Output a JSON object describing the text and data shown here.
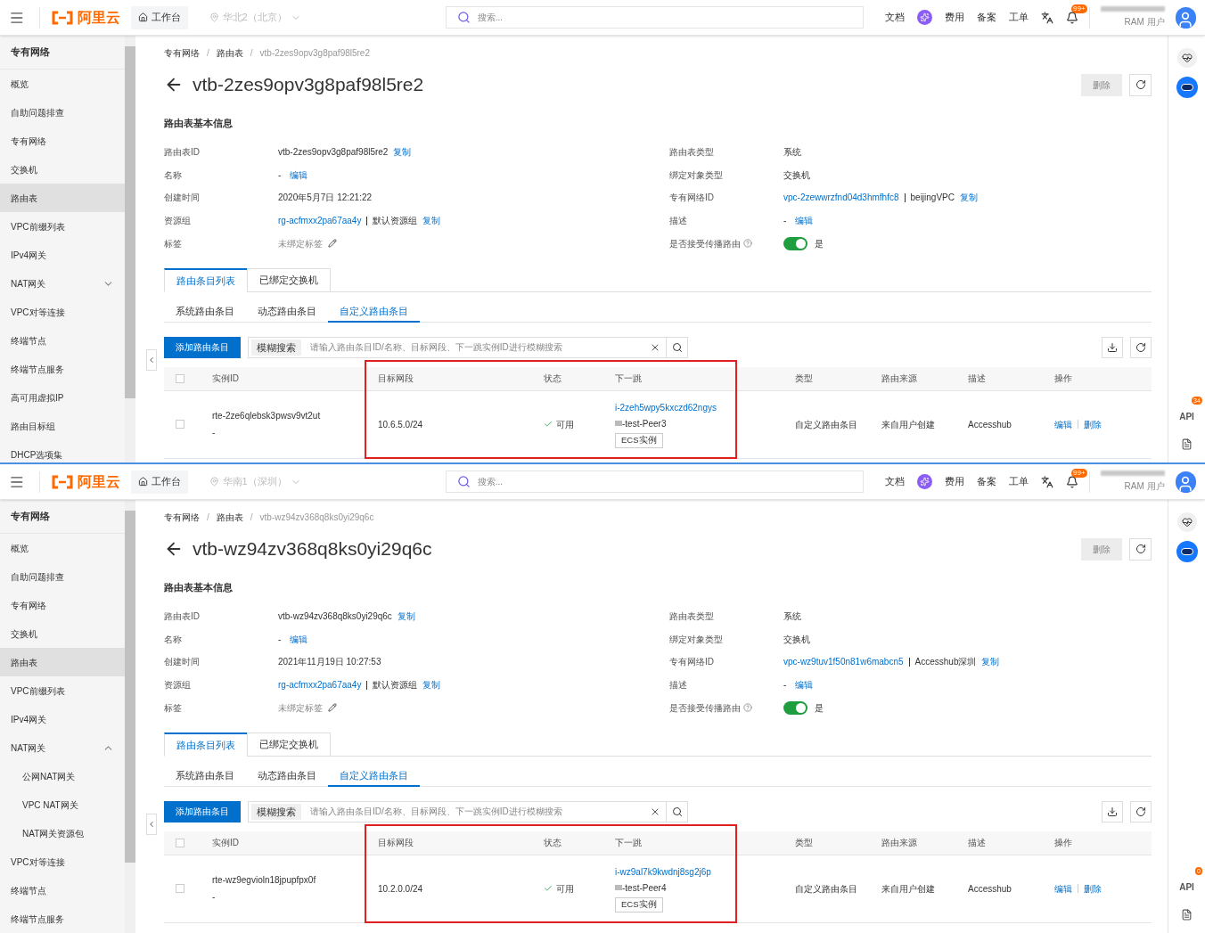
{
  "panels": [
    {
      "header": {
        "logo": "阿里云",
        "workbench": "工作台",
        "region": "华北2（北京）",
        "search_placeholder": "搜索...",
        "nav": [
          {
            "kind": "link",
            "label": "文档"
          },
          {
            "kind": "ai"
          },
          {
            "kind": "link",
            "label": "费用"
          },
          {
            "kind": "link",
            "label": "备案"
          },
          {
            "kind": "link",
            "label": "工单"
          },
          {
            "kind": "translate"
          },
          {
            "kind": "bell",
            "badge": "99+"
          }
        ],
        "user_role": "RAM 用户"
      },
      "sidebar": {
        "title": "专有网络",
        "items": [
          {
            "label": "概览",
            "selected": false
          },
          {
            "label": "自助问题排查",
            "selected": false
          },
          {
            "label": "专有网络",
            "selected": false
          },
          {
            "label": "交换机",
            "selected": false
          },
          {
            "label": "路由表",
            "selected": true
          },
          {
            "label": "VPC前缀列表",
            "selected": false
          },
          {
            "label": "IPv4网关",
            "selected": false
          },
          {
            "label": "NAT网关",
            "selected": false,
            "expanded": false
          },
          {
            "label": "VPC对等连接",
            "selected": false
          },
          {
            "label": "终端节点",
            "selected": false
          },
          {
            "label": "终端节点服务",
            "selected": false
          },
          {
            "label": "高可用虚拟IP",
            "selected": false
          },
          {
            "label": "路由目标组",
            "selected": false
          },
          {
            "label": "DHCP选项集",
            "selected": false
          }
        ]
      },
      "breadcrumb": [
        "专有网络",
        "路由表",
        "vtb-2zes9opv3g8paf98l5re2"
      ],
      "breadcrumb_separator": "/",
      "title": "vtb-2zes9opv3g8paf98l5re2",
      "delete_button": {
        "label": "删除",
        "disabled": true
      },
      "section_title": "路由表基本信息",
      "details_left": [
        {
          "kind": "copyable",
          "label": "路由表ID",
          "value": "vtb-2zes9opv3g8paf98l5re2",
          "action": "复制"
        },
        {
          "kind": "editable",
          "label": "名称",
          "value": "-",
          "action": "编辑"
        },
        {
          "kind": "text",
          "label": "创建时间",
          "value": "2020年5月7日 12:21:22"
        },
        {
          "kind": "link_pair",
          "label": "资源组",
          "link": "rg-acfmxx2pa67aa4y",
          "name": "默认资源组",
          "action": "复制"
        },
        {
          "kind": "tag",
          "label": "标签",
          "value": "未绑定标签"
        }
      ],
      "details_right": [
        {
          "kind": "text",
          "label": "路由表类型",
          "value": "系统"
        },
        {
          "kind": "text",
          "label": "绑定对象类型",
          "value": "交换机"
        },
        {
          "kind": "link_pair",
          "label": "专有网络ID",
          "link": "vpc-2zewwrzfnd04d3hmfhfc8",
          "name": "beijingVPC",
          "action": "复制"
        },
        {
          "kind": "editable",
          "label": "描述",
          "value": "-",
          "action": "编辑"
        },
        {
          "kind": "toggle",
          "label": "是否接受传播路由",
          "on": true,
          "value": "是"
        }
      ],
      "tabs": [
        {
          "label": "路由条目列表",
          "selected": true
        },
        {
          "label": "已绑定交换机",
          "selected": false
        }
      ],
      "subtabs": [
        {
          "label": "系统路由条目",
          "selected": false
        },
        {
          "label": "动态路由条目",
          "selected": false
        },
        {
          "label": "自定义路由条目",
          "selected": true
        }
      ],
      "toolbar": {
        "add": "添加路由条目",
        "filter": "模糊搜索",
        "placeholder": "请输入路由条目ID/名称、目标网段、下一跳实例ID进行模糊搜索"
      },
      "table": {
        "header_checked": false,
        "columns": [
          "实例ID",
          "目标网段",
          "状态",
          "下一跳",
          "类型",
          "路由来源",
          "描述",
          "操作"
        ],
        "rows": [
          {
            "checked": false,
            "instance_id": "rte-2ze6qlebsk3pwsv9vt2ut",
            "instance_name": "-",
            "destination": "10.6.5.0/24",
            "status": {
              "kind": "available",
              "label": "可用"
            },
            "next_hop": {
              "id": "i-2zeh5wpy5kxczd62ngys",
              "name": "-test-Peer3",
              "type": "ECS实例"
            },
            "type": "自定义路由条目",
            "source": "来自用户创建",
            "description": "Accesshub",
            "actions": [
              "编辑",
              "删除"
            ]
          }
        ]
      },
      "rail_api": "API",
      "rail_badge": "34"
    },
    {
      "header": {
        "logo": "阿里云",
        "workbench": "工作台",
        "region": "华南1（深圳）",
        "search_placeholder": "搜索...",
        "nav": [
          {
            "kind": "link",
            "label": "文档"
          },
          {
            "kind": "ai"
          },
          {
            "kind": "link",
            "label": "费用"
          },
          {
            "kind": "link",
            "label": "备案"
          },
          {
            "kind": "link",
            "label": "工单"
          },
          {
            "kind": "translate"
          },
          {
            "kind": "bell",
            "badge": "99+"
          }
        ],
        "user_role": "RAM 用户"
      },
      "sidebar": {
        "title": "专有网络",
        "items": [
          {
            "label": "概览",
            "selected": false
          },
          {
            "label": "自助问题排查",
            "selected": false
          },
          {
            "label": "专有网络",
            "selected": false
          },
          {
            "label": "交换机",
            "selected": false
          },
          {
            "label": "路由表",
            "selected": true
          },
          {
            "label": "VPC前缀列表",
            "selected": false
          },
          {
            "label": "IPv4网关",
            "selected": false
          },
          {
            "label": "NAT网关",
            "selected": false,
            "expanded": true,
            "children": [
              {
                "label": "公网NAT网关",
                "selected": false
              },
              {
                "label": "VPC NAT网关",
                "selected": false
              },
              {
                "label": "NAT网关资源包",
                "selected": false
              }
            ]
          },
          {
            "label": "VPC对等连接",
            "selected": false
          },
          {
            "label": "终端节点",
            "selected": false
          },
          {
            "label": "终端节点服务",
            "selected": false
          }
        ]
      },
      "breadcrumb": [
        "专有网络",
        "路由表",
        "vtb-wz94zv368q8ks0yi29q6c"
      ],
      "breadcrumb_separator": "/",
      "title": "vtb-wz94zv368q8ks0yi29q6c",
      "delete_button": {
        "label": "删除",
        "disabled": true
      },
      "section_title": "路由表基本信息",
      "details_left": [
        {
          "kind": "copyable",
          "label": "路由表ID",
          "value": "vtb-wz94zv368q8ks0yi29q6c",
          "action": "复制"
        },
        {
          "kind": "editable",
          "label": "名称",
          "value": "-",
          "action": "编辑"
        },
        {
          "kind": "text",
          "label": "创建时间",
          "value": "2021年11月19日 10:27:53"
        },
        {
          "kind": "link_pair",
          "label": "资源组",
          "link": "rg-acfmxx2pa67aa4y",
          "name": "默认资源组",
          "action": "复制"
        },
        {
          "kind": "tag",
          "label": "标签",
          "value": "未绑定标签"
        }
      ],
      "details_right": [
        {
          "kind": "text",
          "label": "路由表类型",
          "value": "系统"
        },
        {
          "kind": "text",
          "label": "绑定对象类型",
          "value": "交换机"
        },
        {
          "kind": "link_pair",
          "label": "专有网络ID",
          "link": "vpc-wz9tuv1f50n81w6mabcn5",
          "name": "Accesshub深圳",
          "action": "复制"
        },
        {
          "kind": "editable",
          "label": "描述",
          "value": "-",
          "action": "编辑"
        },
        {
          "kind": "toggle",
          "label": "是否接受传播路由",
          "on": true,
          "value": "是"
        }
      ],
      "tabs": [
        {
          "label": "路由条目列表",
          "selected": true
        },
        {
          "label": "已绑定交换机",
          "selected": false
        }
      ],
      "subtabs": [
        {
          "label": "系统路由条目",
          "selected": false
        },
        {
          "label": "动态路由条目",
          "selected": false
        },
        {
          "label": "自定义路由条目",
          "selected": true
        }
      ],
      "toolbar": {
        "add": "添加路由条目",
        "filter": "模糊搜索",
        "placeholder": "请输入路由条目ID/名称、目标网段、下一跳实例ID进行模糊搜索"
      },
      "table": {
        "header_checked": false,
        "columns": [
          "实例ID",
          "目标网段",
          "状态",
          "下一跳",
          "类型",
          "路由来源",
          "描述",
          "操作"
        ],
        "rows": [
          {
            "checked": false,
            "instance_id": "rte-wz9egvioln18jpupfpx0f",
            "instance_name": "-",
            "destination": "10.2.0.0/24",
            "status": {
              "kind": "available",
              "label": "可用"
            },
            "next_hop": {
              "id": "i-wz9al7k9kwdnj8sg2j6p",
              "name": "-test-Peer4",
              "type": "ECS实例"
            },
            "type": "自定义路由条目",
            "source": "来自用户创建",
            "description": "Accesshub",
            "actions": [
              "编辑",
              "删除"
            ]
          }
        ]
      },
      "rail_api": "API",
      "rail_badge": "0"
    }
  ]
}
